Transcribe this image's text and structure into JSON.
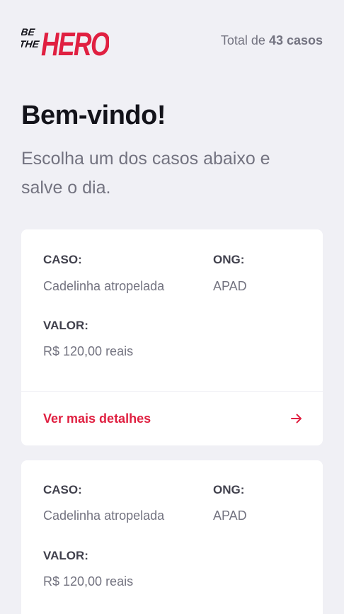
{
  "header": {
    "logo_text": "BE THE HERO",
    "total_prefix": "Total de",
    "total_count": "43 casos"
  },
  "main": {
    "title": "Bem-vindo!",
    "subtitle": "Escolha um dos casos abaixo e salve o dia."
  },
  "labels": {
    "caso": "CASO:",
    "ong": "ONG:",
    "valor": "VALOR:"
  },
  "incidents": [
    {
      "caso": "Cadelinha atropelada",
      "ong": "APAD",
      "valor": "R$ 120,00 reais",
      "details_label": "Ver mais detalhes",
      "details_icon": "arrow-right-icon"
    },
    {
      "caso": "Cadelinha atropelada",
      "ong": "APAD",
      "valor": "R$ 120,00 reais"
    }
  ],
  "colors": {
    "background": "#F0F0F5",
    "brand": "#E02041",
    "card": "#FFFFFF",
    "text_dark": "#13131A",
    "text_muted": "#737380"
  }
}
